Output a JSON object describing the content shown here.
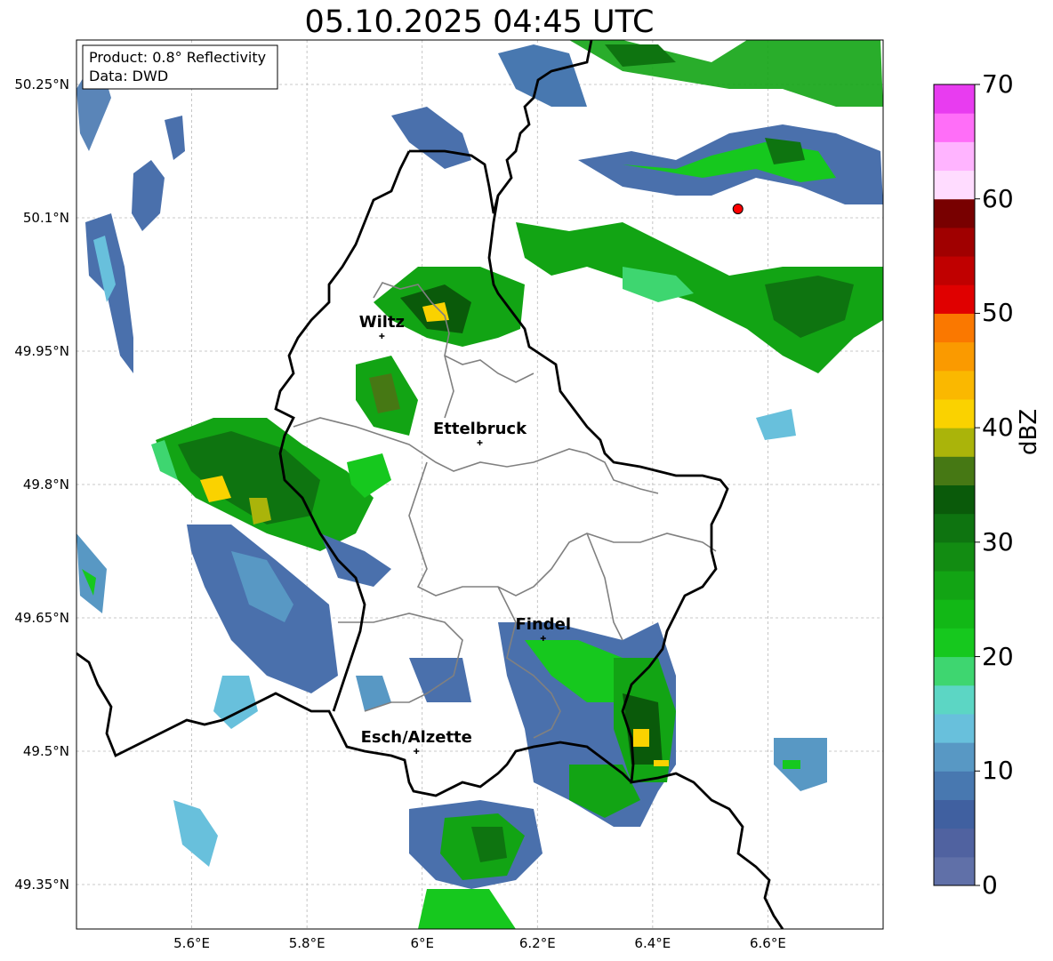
{
  "title": "05.10.2025 04:45 UTC",
  "info_box": {
    "product": "Product: 0.8° Reflectivity",
    "data": "Data: DWD"
  },
  "map": {
    "lon_range": [
      5.4,
      6.8
    ],
    "lat_range": [
      49.3,
      50.3
    ],
    "x_ticks": [
      {
        "value": 5.6,
        "label": "5.6°E"
      },
      {
        "value": 5.8,
        "label": "5.8°E"
      },
      {
        "value": 6.0,
        "label": "6°E"
      },
      {
        "value": 6.2,
        "label": "6.2°E"
      },
      {
        "value": 6.4,
        "label": "6.4°E"
      },
      {
        "value": 6.6,
        "label": "6.6°E"
      }
    ],
    "y_ticks": [
      {
        "value": 50.25,
        "label": "50.25°N"
      },
      {
        "value": 50.1,
        "label": "50.1°N"
      },
      {
        "value": 49.95,
        "label": "49.95°N"
      },
      {
        "value": 49.8,
        "label": "49.8°N"
      },
      {
        "value": 49.65,
        "label": "49.65°N"
      },
      {
        "value": 49.5,
        "label": "49.5°N"
      },
      {
        "value": 49.35,
        "label": "49.35°N"
      }
    ],
    "gridlines": true,
    "cities": [
      {
        "name": "Wiltz",
        "lon": 5.93,
        "lat": 49.967
      },
      {
        "name": "Ettelbruck",
        "lon": 6.1,
        "lat": 49.847
      },
      {
        "name": "Findel",
        "lon": 6.21,
        "lat": 49.627
      },
      {
        "name": "Esch/Alzette",
        "lon": 5.99,
        "lat": 49.5
      }
    ],
    "radar_site": {
      "lon": 6.548,
      "lat": 50.11,
      "color": "#ff0000"
    }
  },
  "colorbar": {
    "label": "dBZ",
    "min": 0,
    "max": 70,
    "tick_values": [
      0,
      10,
      20,
      30,
      40,
      50,
      60,
      70
    ],
    "colors": [
      "#6070a8",
      "#5062a0",
      "#4060a0",
      "#4878b0",
      "#5898c4",
      "#68c0dc",
      "#5cd6c4",
      "#3ed670",
      "#16c81e",
      "#12b816",
      "#12a414",
      "#128c12",
      "#0e7410",
      "#0a5a0a",
      "#467814",
      "#aab40a",
      "#fad200",
      "#fab800",
      "#fa9a00",
      "#fa7800",
      "#e00000",
      "#c00000",
      "#a00000",
      "#780000",
      "#ffdcff",
      "#ffb4ff",
      "#ff6ef8",
      "#e83cf0"
    ]
  },
  "legend_colors": {
    "strong_echo": "#f0c800",
    "land_boundary": "#000000",
    "canton_boundary": "#808080"
  }
}
